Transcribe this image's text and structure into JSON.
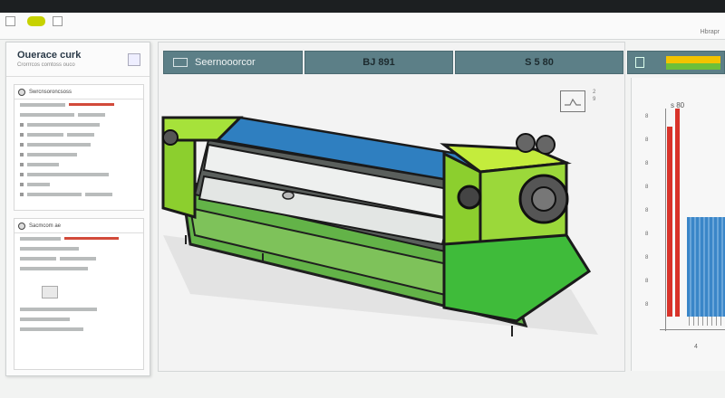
{
  "app": {
    "title": "Ouerace curk",
    "subtitle": "Crorrrcos comtoss ouco",
    "corner_text": "Hbrapr"
  },
  "header_bars": [
    {
      "label": "Seernooorcor",
      "icon": "monitor-icon"
    },
    {
      "label": "BJ 891",
      "icon": ""
    },
    {
      "label": "S 5 80",
      "icon": ""
    }
  ],
  "sidebar": {
    "panel1_title": "Swrcnsoroncsoss",
    "panel2_title": "Sacmcom ae"
  },
  "chart": {
    "title": "s 80",
    "y_ticks": [
      "8",
      "8",
      "8",
      "8",
      "8",
      "8",
      "8",
      "8",
      "8"
    ],
    "x_label": "4",
    "colors": {
      "red": "#d8332a",
      "blue": "#3a86c8"
    }
  },
  "machine": {
    "colors": {
      "frame": "#8ccf2e",
      "body": "#63b348",
      "belt": "#2f7fc0",
      "roller": "#eef0ef"
    }
  },
  "status_icons": [
    "2",
    "9"
  ]
}
